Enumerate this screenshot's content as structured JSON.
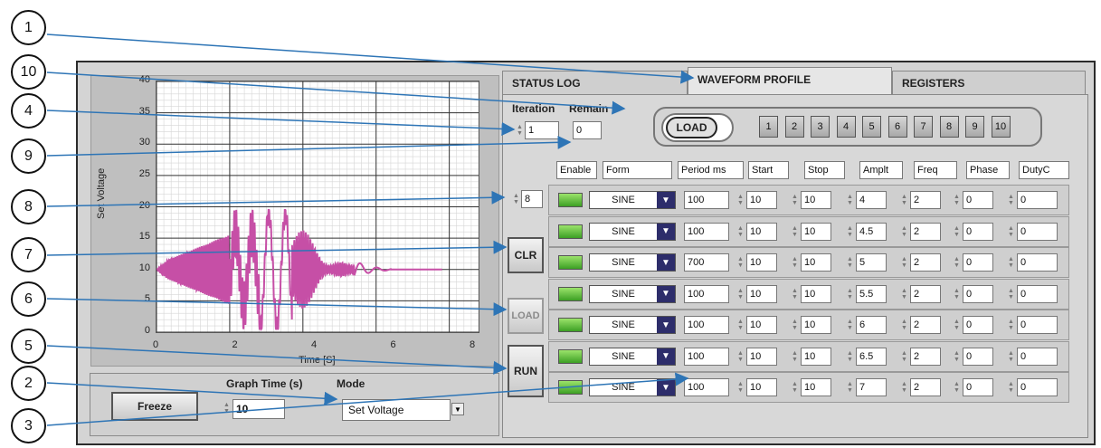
{
  "callouts": [
    "1",
    "10",
    "4",
    "9",
    "8",
    "7",
    "6",
    "5",
    "2",
    "3"
  ],
  "tabs": {
    "status_log": "STATUS LOG",
    "waveform_profile": "WAVEFORM PROFILE",
    "registers": "REGISTERS"
  },
  "graph": {
    "ylabel": "Set Voltage",
    "xlabel": "Time [S]",
    "y_ticks": [
      "0",
      "5",
      "10",
      "15",
      "20",
      "25",
      "30",
      "35",
      "40"
    ],
    "x_ticks": [
      "0",
      "2",
      "4",
      "6",
      "8"
    ]
  },
  "chart_data": {
    "type": "line",
    "xlabel": "Time [S]",
    "ylabel": "Set Voltage",
    "xlim": [
      0,
      8.8
    ],
    "ylim": [
      0,
      40
    ],
    "grid": true,
    "series_color": "#c64fa6"
  },
  "bottom": {
    "freeze": "Freeze",
    "graph_time_label": "Graph Time (s)",
    "graph_time_value": "10",
    "mode_label": "Mode",
    "mode_value": "Set Voltage"
  },
  "side": {
    "iteration_label": "Iteration",
    "iteration_value": "1",
    "remain_label": "Remain",
    "remain_value": "0",
    "rows_value": "8",
    "clr": "CLR",
    "load": "LOAD",
    "run": "RUN"
  },
  "load_group": {
    "load_button": "LOAD",
    "slots": [
      "1",
      "2",
      "3",
      "4",
      "5",
      "6",
      "7",
      "8",
      "9",
      "10"
    ]
  },
  "headers": [
    "Enable",
    "Form",
    "Period ms",
    "Start",
    "Stop",
    "Amplt",
    "Freq",
    "Phase",
    "DutyC"
  ],
  "rows": [
    {
      "form": "SINE",
      "period": "100",
      "start": "10",
      "stop": "10",
      "amplt": "4",
      "freq": "2",
      "phase": "0",
      "duty": "0"
    },
    {
      "form": "SINE",
      "period": "100",
      "start": "10",
      "stop": "10",
      "amplt": "4.5",
      "freq": "2",
      "phase": "0",
      "duty": "0"
    },
    {
      "form": "SINE",
      "period": "700",
      "start": "10",
      "stop": "10",
      "amplt": "5",
      "freq": "2",
      "phase": "0",
      "duty": "0"
    },
    {
      "form": "SINE",
      "period": "100",
      "start": "10",
      "stop": "10",
      "amplt": "5.5",
      "freq": "2",
      "phase": "0",
      "duty": "0"
    },
    {
      "form": "SINE",
      "period": "100",
      "start": "10",
      "stop": "10",
      "amplt": "6",
      "freq": "2",
      "phase": "0",
      "duty": "0"
    },
    {
      "form": "SINE",
      "period": "100",
      "start": "10",
      "stop": "10",
      "amplt": "6.5",
      "freq": "2",
      "phase": "0",
      "duty": "0"
    },
    {
      "form": "SINE",
      "period": "100",
      "start": "10",
      "stop": "10",
      "amplt": "7",
      "freq": "2",
      "phase": "0",
      "duty": "0"
    }
  ]
}
